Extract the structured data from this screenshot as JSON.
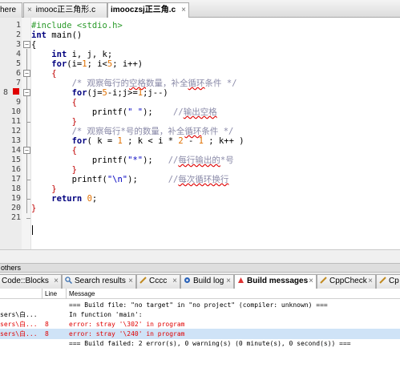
{
  "editor_tabs": [
    {
      "label": "here",
      "close": "×"
    },
    {
      "label": "imooc正三角形.c",
      "close": "×"
    },
    {
      "label": "imooczsj正三角.c",
      "close": "×"
    }
  ],
  "lines": [
    "1",
    "2",
    "3",
    "4",
    "5",
    "6",
    "7",
    "8",
    "9",
    "10",
    "11",
    "12",
    "13",
    "14",
    "15",
    "16",
    "17",
    "18",
    "19",
    "20",
    "21"
  ],
  "code": {
    "l1a": "#include <stdio.h>",
    "l2a": "int",
    "l2b": " main()",
    "l3a": "{",
    "l4a": "int",
    "l4b": " i, j, k;",
    "l5a": "for",
    "l5b": "(i=",
    "l5c": "1",
    "l5d": "; i<",
    "l5e": "5",
    "l5f": "; i++)",
    "l6a": "{",
    "l7a": "/* 观察每行的",
    "l7b": "空格",
    "l7c": "数量，补全",
    "l7d": "循环",
    "l7e": "条件 */",
    "l8a": "for",
    "l8b": "(j=",
    "l8c": "5",
    "l8d": "-i;j>=",
    "l8e": "1",
    "l8f": ";j--)",
    "l9a": "{",
    "l10a": "printf(",
    "l10b": "\" \"",
    "l10c": ");",
    "l10d": "//",
    "l10e": "输出空格",
    "l11a": "}",
    "l12a": "/* 观察每行*号的数量，补全",
    "l12b": "循环",
    "l12c": "条件 */",
    "l13a": "for",
    "l13b": "( k = ",
    "l13c": "1",
    "l13d": " ; k < i * ",
    "l13e": "2",
    "l13f": " - ",
    "l13g": "1",
    "l13h": " ; k++ )",
    "l14a": "{",
    "l15a": "printf(",
    "l15b": "\"*\"",
    "l15c": ");",
    "l15d": "//",
    "l15e": "每行输出的",
    "l15f": "*号",
    "l16a": "}",
    "l17a": "printf(",
    "l17b": "\"\\n\"",
    "l17c": ");",
    "l17d": "//",
    "l17e": "每次循环换行",
    "l18a": "}",
    "l19a": "return",
    "l19b": " ",
    "l19c": "0",
    "l19d": ";",
    "l20a": "}"
  },
  "panel": {
    "title": "others",
    "tabs": [
      {
        "label": "Code::Blocks",
        "close": "×"
      },
      {
        "label": "Search results",
        "close": "×"
      },
      {
        "label": "Cccc",
        "close": "×"
      },
      {
        "label": "Build log",
        "close": "×"
      },
      {
        "label": "Build messages",
        "close": "×"
      },
      {
        "label": "CppCheck",
        "close": "×"
      },
      {
        "label": "Cp"
      }
    ],
    "columns": {
      "file": "",
      "line": "Line",
      "message": "Message"
    },
    "rows": [
      {
        "file": "",
        "line": "",
        "message": "=== Build file: \"no target\" in \"no project\" (compiler: unknown) ==="
      },
      {
        "file": "sers\\白...",
        "line": "",
        "message": "In function 'main':"
      },
      {
        "file": "sers\\白...",
        "line": "8",
        "message": "error: stray '\\302' in program"
      },
      {
        "file": "sers\\白...",
        "line": "8",
        "message": "error: stray '\\240' in program"
      },
      {
        "file": "",
        "line": "",
        "message": "=== Build failed: 2 error(s), 0 warning(s) (0 minute(s), 0 second(s)) ==="
      }
    ]
  },
  "colors": {
    "error": "#e00000",
    "highlight": "#cfe3f7",
    "marker": "#e00000"
  }
}
